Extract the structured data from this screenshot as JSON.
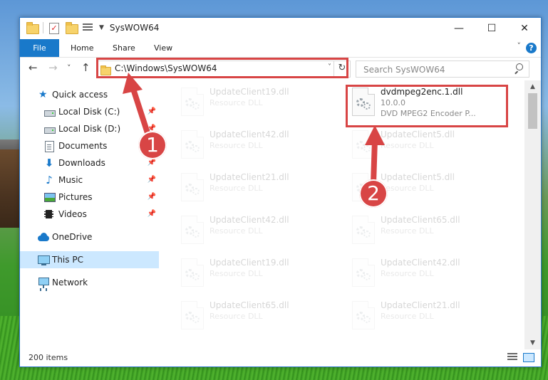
{
  "window": {
    "title": "SysWOW64",
    "controls": {
      "minimize": "—",
      "maximize": "☐",
      "close": "✕"
    }
  },
  "ribbon": {
    "file": "File",
    "tabs": [
      "Home",
      "Share",
      "View"
    ],
    "help": "?",
    "collapse": "˅"
  },
  "navbar": {
    "back": "←",
    "forward": "→",
    "recent": "˅",
    "up": "↑",
    "address": "C:\\Windows\\SysWOW64",
    "address_dropdown": "˅",
    "refresh": "↻",
    "search_placeholder": "Search SysWOW64"
  },
  "sidebar": {
    "quick_access": "Quick access",
    "items": [
      {
        "label": "Local Disk (C:)",
        "icon": "drive-icon",
        "pinned": true
      },
      {
        "label": "Local Disk (D:)",
        "icon": "drive-icon",
        "pinned": true
      },
      {
        "label": "Documents",
        "icon": "documents-icon",
        "pinned": true
      },
      {
        "label": "Downloads",
        "icon": "downloads-icon",
        "pinned": true
      },
      {
        "label": "Music",
        "icon": "music-icon",
        "pinned": true
      },
      {
        "label": "Pictures",
        "icon": "pictures-icon",
        "pinned": true
      },
      {
        "label": "Videos",
        "icon": "videos-icon",
        "pinned": true
      }
    ],
    "onedrive": "OneDrive",
    "this_pc": "This PC",
    "network": "Network",
    "pin_glyph": "📌"
  },
  "files": {
    "highlighted": {
      "name": "dvdmpeg2enc.1.dll",
      "version": "10.0.0",
      "description": "DVD MPEG2 Encoder P..."
    },
    "left_column": [
      {
        "name": "UpdateClient19.dll",
        "type": "Resource DLL"
      },
      {
        "name": "UpdateClient42.dll",
        "type": "Resource DLL"
      },
      {
        "name": "UpdateClient21.dll",
        "type": "Resource DLL"
      },
      {
        "name": "UpdateClient42.dll",
        "type": "Resource DLL"
      },
      {
        "name": "UpdateClient19.dll",
        "type": "Resource DLL"
      },
      {
        "name": "UpdateClient65.dll",
        "type": "Resource DLL"
      }
    ],
    "right_column": [
      {
        "name": "UpdateClient5.dll",
        "type": "Resource DLL"
      },
      {
        "name": "UpdateClient5.dll",
        "type": "Resource DLL"
      },
      {
        "name": "UpdateClient65.dll",
        "type": "Resource DLL"
      },
      {
        "name": "UpdateClient42.dll",
        "type": "Resource DLL"
      },
      {
        "name": "UpdateClient21.dll",
        "type": "Resource DLL"
      }
    ]
  },
  "annotations": {
    "step1": "1",
    "step2": "2",
    "highlight_color": "#d84545"
  },
  "status": {
    "items": "200 items"
  },
  "colors": {
    "accent": "#1979ca",
    "selection": "#cce8ff"
  }
}
